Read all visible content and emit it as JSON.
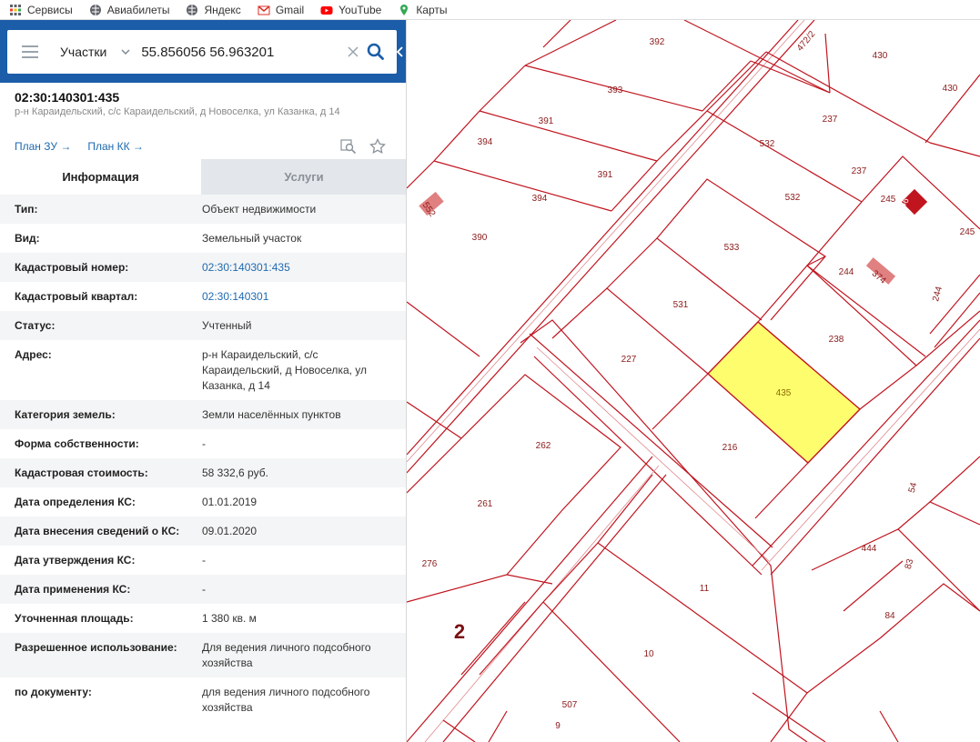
{
  "bookmarks": [
    {
      "label": "Сервисы",
      "icon": "apps-icon"
    },
    {
      "label": "Авиабилеты",
      "icon": "globe-icon"
    },
    {
      "label": "Яндекс",
      "icon": "globe-icon"
    },
    {
      "label": "Gmail",
      "icon": "gmail-icon"
    },
    {
      "label": "YouTube",
      "icon": "youtube-icon"
    },
    {
      "label": "Карты",
      "icon": "maps-icon"
    }
  ],
  "search": {
    "type": "Участки",
    "value": "55.856056 56.963201"
  },
  "object": {
    "cadastral_number": "02:30:140301:435",
    "address_short": "р-н Караидельский, с/с Караидельский, д Новоселка, ул Казанка, д 14",
    "link_plan_zu": "План ЗУ →",
    "link_plan_kk": "План КК →"
  },
  "tabs": {
    "info": "Информация",
    "services": "Услуги"
  },
  "rows": [
    {
      "label": "Тип:",
      "value": "Объект недвижимости"
    },
    {
      "label": "Вид:",
      "value": "Земельный участок"
    },
    {
      "label": "Кадастровый номер:",
      "value": "02:30:140301:435"
    },
    {
      "label": "Кадастровый квартал:",
      "value": "02:30:140301"
    },
    {
      "label": "Статус:",
      "value": "Учтенный"
    },
    {
      "label": "Адрес:",
      "value": "р-н Караидельский, с/с Караидельский, д Новоселка, ул Казанка, д 14"
    },
    {
      "label": "Категория земель:",
      "value": "Земли населённых пунктов"
    },
    {
      "label": "Форма собственности:",
      "value": "-"
    },
    {
      "label": "Кадастровая стоимость:",
      "value": "58 332,6 руб."
    },
    {
      "label": "Дата определения КС:",
      "value": "01.01.2019"
    },
    {
      "label": "Дата внесения сведений о КС:",
      "value": "09.01.2020"
    },
    {
      "label": "Дата утверждения КС:",
      "value": "-"
    },
    {
      "label": "Дата применения КС:",
      "value": "-"
    },
    {
      "label": "Уточненная площадь:",
      "value": "1 380 кв. м"
    },
    {
      "label": "Разрешенное использование:",
      "value": "Для ведения личного подсобного хозяйства"
    },
    {
      "label": "по документу:",
      "value": "для ведения личного подсобного хозяйства"
    }
  ],
  "map": {
    "parcel_labels": [
      "392",
      "430",
      "430",
      "472/2",
      "393",
      "391",
      "237",
      "532",
      "394",
      "391",
      "237",
      "552",
      "245",
      "366",
      "394",
      "532",
      "245",
      "390",
      "533",
      "244",
      "374",
      "531",
      "238",
      "244",
      "227",
      "435",
      "216",
      "262",
      "54",
      "261",
      "444",
      "83",
      "276",
      "11",
      "84",
      "2",
      "10",
      "507",
      "9"
    ],
    "highlight_color": "#fdfd6e",
    "line_color": "#c0141e"
  }
}
